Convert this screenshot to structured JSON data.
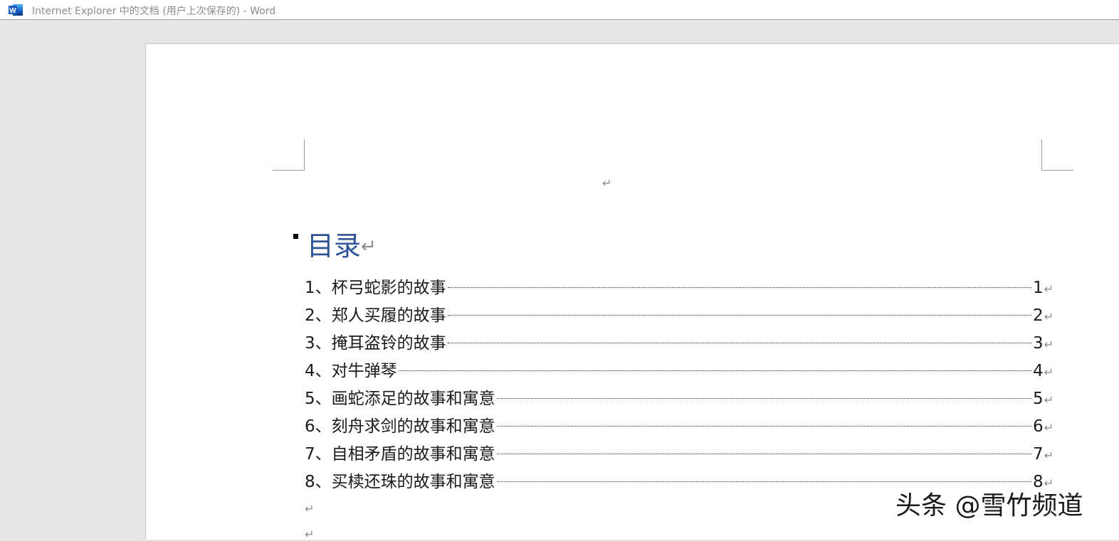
{
  "window": {
    "title": "Internet Explorer 中的文档 (用户上次保存的) - Word",
    "app_icon": "word-icon"
  },
  "document": {
    "paragraph_mark": "↵",
    "heading": "目录",
    "toc": [
      {
        "title": "1、杯弓蛇影的故事",
        "page": "1"
      },
      {
        "title": "2、郑人买履的故事",
        "page": "2"
      },
      {
        "title": "3、掩耳盗铃的故事",
        "page": "3"
      },
      {
        "title": "4、对牛弹琴",
        "page": "4"
      },
      {
        "title": "5、画蛇添足的故事和寓意",
        "page": "5"
      },
      {
        "title": "6、刻舟求剑的故事和寓意",
        "page": "6"
      },
      {
        "title": "7、自相矛盾的故事和寓意",
        "page": "7"
      },
      {
        "title": "8、买椟还珠的故事和寓意",
        "page": "8"
      }
    ]
  },
  "watermark": "头条 @雪竹频道",
  "colors": {
    "heading": "#2f5597",
    "word_blue": "#2b579a",
    "workspace": "#e6e6e6"
  }
}
